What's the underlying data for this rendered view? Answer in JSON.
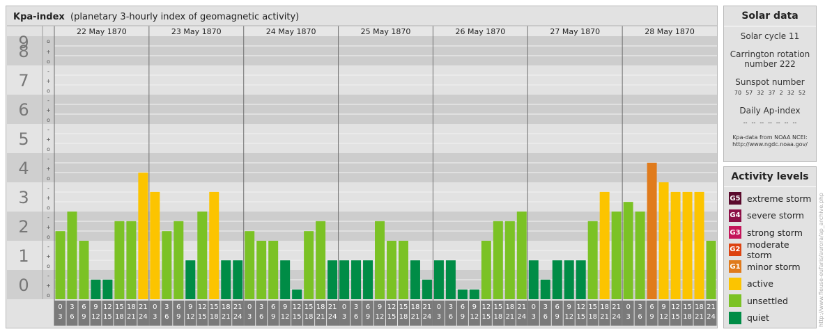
{
  "title": {
    "main": "Kpa-index",
    "sub": "(planetary 3-hourly index of geomagnetic activity)"
  },
  "chart_data": {
    "type": "bar",
    "days": [
      "22 May 1870",
      "23 May 1870",
      "24 May 1870",
      "25 May 1870",
      "26 May 1870",
      "27 May 1870",
      "28 May 1870"
    ],
    "time_bins": [
      [
        "0",
        "3"
      ],
      [
        "3",
        "6"
      ],
      [
        "6",
        "9"
      ],
      [
        "9",
        "12"
      ],
      [
        "12",
        "15"
      ],
      [
        "15",
        "18"
      ],
      [
        "18",
        "21"
      ],
      [
        "21",
        "24"
      ]
    ],
    "y_ticks": [
      "0",
      "1",
      "2",
      "3",
      "4",
      "5",
      "6",
      "7",
      "8",
      "9"
    ],
    "sub_ticks": [
      "o",
      "+",
      "-"
    ],
    "ylim": [
      0,
      9
    ],
    "values": [
      [
        2.33,
        3.0,
        2.0,
        0.67,
        0.67,
        2.67,
        2.67,
        4.33
      ],
      [
        3.67,
        2.33,
        2.67,
        1.33,
        3.0,
        3.67,
        1.33,
        1.33
      ],
      [
        2.33,
        2.0,
        2.0,
        1.33,
        0.33,
        2.33,
        2.67,
        1.33
      ],
      [
        1.33,
        1.33,
        1.33,
        2.67,
        2.0,
        2.0,
        1.33,
        0.67
      ],
      [
        1.33,
        1.33,
        0.33,
        0.33,
        2.0,
        2.67,
        2.67,
        3.0
      ],
      [
        1.33,
        0.67,
        1.33,
        1.33,
        1.33,
        2.67,
        3.67,
        3.0
      ],
      [
        3.33,
        3.0,
        4.67,
        4.0,
        3.67,
        3.67,
        3.67,
        2.0
      ]
    ],
    "colors": {
      "quiet": "#008c46",
      "unsettled": "#7bc225",
      "active": "#fcc400",
      "minor": "#e07b1c",
      "moderate": "#dd4311",
      "strong": "#c4155a",
      "severe": "#8c0f46",
      "extreme": "#5a0a2c"
    }
  },
  "solar": {
    "heading": "Solar data",
    "cycle": "Solar cycle 11",
    "carrington_line1": "Carrington rotation",
    "carrington_line2": "number 222",
    "sunspot_label": "Sunspot number",
    "sunspots": [
      "70",
      "57",
      "32",
      "37",
      "2",
      "32",
      "52"
    ],
    "ap_label": "Daily Ap-index",
    "ap_values": [
      "--",
      "--",
      "--",
      "--",
      "--",
      "--",
      "--"
    ],
    "source_line1": "Kpa-data from NOAA NCEI:",
    "source_line2": "http://www.ngdc.noaa.gov/"
  },
  "activity": {
    "heading": "Activity levels",
    "levels": [
      {
        "code": "G5",
        "label": "extreme storm",
        "color": "#5a0a2c"
      },
      {
        "code": "G4",
        "label": "severe storm",
        "color": "#8c0f46"
      },
      {
        "code": "G3",
        "label": "strong storm",
        "color": "#c4155a"
      },
      {
        "code": "G2",
        "label": "moderate storm",
        "color": "#dd4311"
      },
      {
        "code": "G1",
        "label": "minor storm",
        "color": "#e07b1c"
      },
      {
        "code": "",
        "label": "active",
        "color": "#fcc400"
      },
      {
        "code": "",
        "label": "unsettled",
        "color": "#7bc225"
      },
      {
        "code": "",
        "label": "quiet",
        "color": "#008c46"
      }
    ]
  },
  "watermark": "http://www.fleuse-eufaris/aurora/ap_archive.php"
}
